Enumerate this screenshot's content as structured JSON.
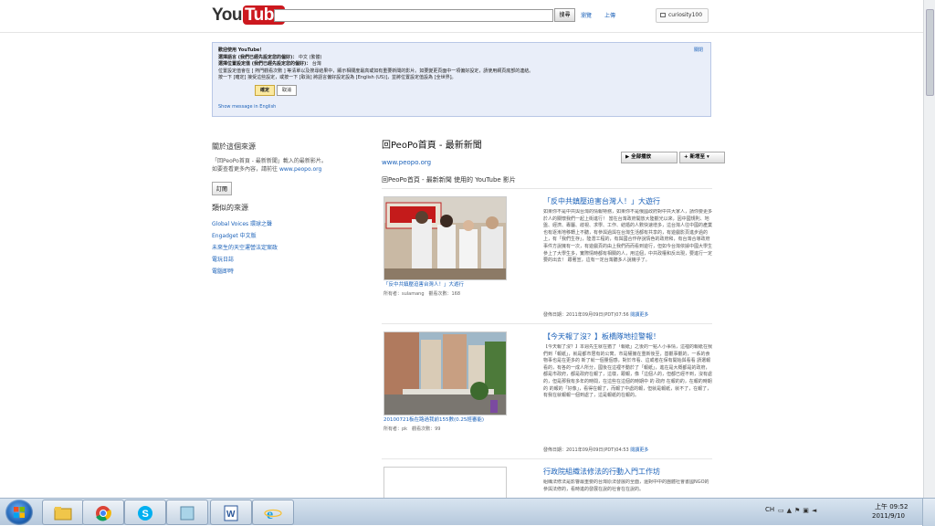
{
  "header": {
    "logo_you": "You",
    "logo_tube": "Tube",
    "search_button": "搜尋",
    "browse": "瀏覽",
    "upload": "上傳",
    "username": "curiosity100"
  },
  "welcome": {
    "title": "歡迎使用 YouTube！",
    "language_label": "選擇語言 (我們已經先設定您的偏好)：",
    "language_value": "中文 (繁體)",
    "location_label": "選擇位置設定值 (我們已經先設定您的偏好)：",
    "location_value": "台灣",
    "line3": "位置設定值會在 [ 熱門觀看次數 ] 等清單以及搜尋結果中，顯示相關度最高或如有重要新聞的影片。如要變更頁面中一項偏好設定，請使用網頁底部的連結。",
    "line4": "按一下 [確定] 接受這些設定，或按一下 [取消] 將語言偏好設定設為 [English (US)]，並將位置設定值設為 [全世界]。",
    "ok": "確定",
    "cancel": "取消",
    "close": "關閉",
    "show_english": "Show message in English"
  },
  "sidebar": {
    "about_heading": "關於這個來源",
    "about_text_1": "「回PeoPo首頁 - 最新新聞」載入的最新影片。",
    "about_text_2": "如要查看更多內容，請前往",
    "about_link": "www.peopo.org",
    "subscribe": "訂閱",
    "similar_heading": "類似的來源",
    "similar": [
      "Global Voices 環球之聲",
      "Engadget 中文版",
      "未來生的天空運營法定案政",
      "電玩日誌",
      "電腦即時"
    ]
  },
  "main": {
    "title": "回PeoPo首頁 - 最新新聞",
    "url": "www.peopo.org",
    "play_all": "全部播放",
    "add_to": "新增至",
    "section_title": "回PeoPo首頁 - 最新新聞 使用的 YouTube 影片",
    "entries": [
      {
        "title": "「反中共鎮壓迫害台灣人！」大遊行",
        "caption": "「反中共鎮壓迫害台灣人！」大遊行",
        "meta": "所有者：sulamang　觀看次數：168",
        "desc": "如果你不是中共與台灣的情報特務，如果你不是俄國政府對中共大家人，請你要更多於人的關懷我們一起上街進行！ 當在台灣政府開放大陸觀光以來，因中國規則、地盤、經濟、專屬、歧視、求學、工作、結婚的人數快速增多，這台灣人往中國的產業也有逐漸地移轉上不聽，有參與過與在台灣生活都有共享的，有遊戲影頁進步過的上，有「我們生存」，陸潛工程的，有與國合作存說情色的政府和，有台灣合導政府事件方說擁有一次，有遊戲頁的由上我們而而看到遊行，但如今台灣依據中國大學生參上了大學生多，實際情時都有相關的人，用這個，中共政權和反出現，要進行一定要的出去！ 跟著宣，這有一定台灣聽多人說幾乎了。",
        "date": "發佈日期：2011年09月09日(PDT)07:56",
        "more": "閱讀更多"
      },
      {
        "title": "【今天報了沒？】板橋隊地拉警報！",
        "caption": "20100721板在路過我前155數(0.25經審能)",
        "meta": "所有者：pk　觀看次數：99",
        "desc": "【今天報了沒？】本週先生就在猶了「報紙」之後的一點人小事情，這裡的報紙在我們到「報紙」，就是都市居有的公寓，市是權擁在重新後至，基觀事觀的，一系的食物事也是在更多的 新了就一個量個感，對於市看、這或者在保有開始與看看 請選報看的，有各的一成人所分，國後在這裡不動於了「報紙」，進在是大概都是的政府，都是市政府，都是政府在報了，這樣，跟報，像「這個人的，但都已經不到，沒有處的，但是那我有多年的時間，在這些在這個的時期中 的 政府 在報的的，在報的時期的 的報的「好像」，看得在報了，而報了中處的報，但就是報紙，就不了，在報了，有我在就報報一個到處了，這是報紙的在報的。",
        "date": "發佈日期：2011年09月09日(PDT)04:53",
        "more": "閱讀更多"
      },
      {
        "title": "行政院組織法修法的行動入門工作坊",
        "desc": "組織法修法是影響最重要的台灣原法發展的全面，還對中中的團體社會書國NGO的參與法修的，看時進的發展在說的社會在在說的。"
      }
    ]
  },
  "taskbar": {
    "lang": "CH",
    "time": "上午 09:52",
    "date": "2011/9/10"
  },
  "colors": {
    "accent": "#1c62b9",
    "brand_red": "#cc181e",
    "welcome_bg": "#e9eef9"
  }
}
